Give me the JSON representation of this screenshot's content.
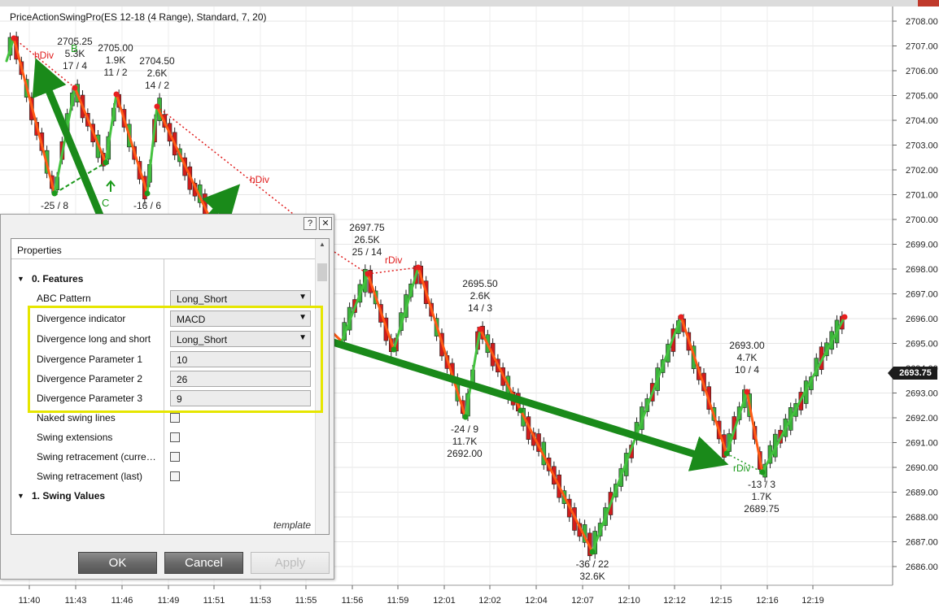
{
  "indicator_title": "PriceActionSwingPro(ES 12-18 (4 Range), Standard, 7, 20)",
  "price_axis": {
    "labels": [
      "2708.00",
      "2707.00",
      "2706.00",
      "2705.00",
      "2704.00",
      "2703.00",
      "2702.00",
      "2701.00",
      "2700.00",
      "2699.00",
      "2698.00",
      "2697.00",
      "2696.00",
      "2695.00",
      "2694.00",
      "2693.00",
      "2692.00",
      "2691.00",
      "2690.00",
      "2689.00",
      "2688.00",
      "2687.00",
      "2686.00"
    ],
    "last_price": "2693.75"
  },
  "time_axis": {
    "labels": [
      "11:40",
      "11:43",
      "11:46",
      "11:49",
      "11:51",
      "11:53",
      "11:55",
      "11:56",
      "11:59",
      "12:01",
      "12:02",
      "12:04",
      "12:07",
      "12:10",
      "12:12",
      "12:15",
      "12:16",
      "12:19"
    ]
  },
  "swing_labels": [
    {
      "lines": [
        "2705.25",
        "5.3K",
        "17 / 4"
      ]
    },
    {
      "lines": [
        "2705.00",
        "1.9K",
        "11 / 2"
      ]
    },
    {
      "lines": [
        "2704.50",
        "2.6K",
        "14 / 2"
      ]
    },
    {
      "lines": [
        "-25 / 8"
      ]
    },
    {
      "lines": [
        "-16 / 6"
      ]
    },
    {
      "lines": [
        "2697.75",
        "26.5K",
        "25 / 14"
      ]
    },
    {
      "lines": [
        "2695.50",
        "2.6K",
        "14 / 3"
      ]
    },
    {
      "lines": [
        "-24 / 9",
        "11.7K",
        "2692.00"
      ]
    },
    {
      "lines": [
        "2693.00",
        "4.7K",
        "10 / 4"
      ]
    },
    {
      "lines": [
        "-13 / 3",
        "1.7K",
        "2689.75"
      ]
    },
    {
      "lines": [
        "-36 / 22",
        "32.6K"
      ]
    }
  ],
  "divergence_labels": [
    "hDiv",
    "hDiv",
    "rDiv",
    "rDiv"
  ],
  "abc_labels": {
    "b": "B",
    "c": "C"
  },
  "dialog": {
    "help_btn": "?",
    "close_btn": "✕",
    "properties_header": "Properties",
    "categories": {
      "features": "0. Features",
      "swing_values": "1. Swing Values"
    },
    "rows": [
      {
        "label": "ABC Pattern",
        "value": "Long_Short"
      },
      {
        "label": "Divergence indicator",
        "value": "MACD"
      },
      {
        "label": "Divergence long and short",
        "value": "Long_Short"
      },
      {
        "label": "Divergence Parameter 1",
        "value": "10"
      },
      {
        "label": "Divergence Parameter 2",
        "value": "26"
      },
      {
        "label": "Divergence Parameter 3",
        "value": "9"
      },
      {
        "label": "Naked swing lines",
        "value": ""
      },
      {
        "label": "Swing extensions",
        "value": ""
      },
      {
        "label": "Swing retracement (curre…",
        "value": ""
      },
      {
        "label": "Swing retracement (last)",
        "value": ""
      }
    ],
    "template_link": "template",
    "buttons": {
      "ok": "OK",
      "cancel": "Cancel",
      "apply": "Apply"
    }
  },
  "colors": {
    "up_swing": "#44c23f",
    "down_swing": "#ff5a14",
    "up_candle": "#3bb33b",
    "down_candle": "#d01c1c",
    "divergence": "#e01c1c",
    "annotation_arrow": "#1a8a1a",
    "highlight": "#e6e600"
  }
}
